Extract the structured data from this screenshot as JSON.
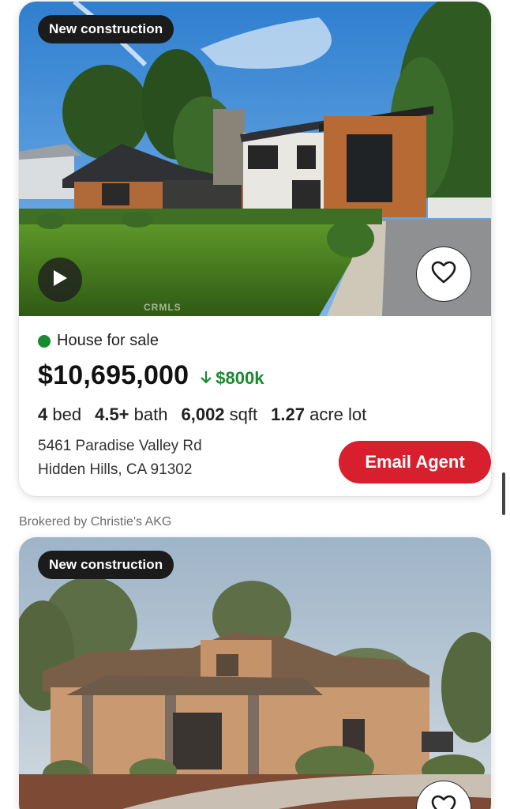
{
  "listings": [
    {
      "badge": "New construction",
      "status": "House for sale",
      "price": "$10,695,000",
      "price_drop": "$800k",
      "specs": {
        "beds": "4",
        "beds_label": "bed",
        "baths": "4.5+",
        "baths_label": "bath",
        "sqft": "6,002",
        "sqft_label": "sqft",
        "lot": "1.27",
        "lot_label": "acre lot"
      },
      "address_line1": "5461 Paradise Valley Rd",
      "address_line2": "Hidden Hills, CA 91302",
      "cta_label": "Email Agent",
      "watermark": "CRMLS",
      "broker": "Brokered by Christie's AKG"
    },
    {
      "badge": "New construction"
    }
  ],
  "colors": {
    "accent_red": "#d81f2e",
    "status_green": "#1a8a2e",
    "badge_bg": "#1b1b1b"
  },
  "icons": [
    "play-icon",
    "heart-icon",
    "arrow-down-icon"
  ]
}
